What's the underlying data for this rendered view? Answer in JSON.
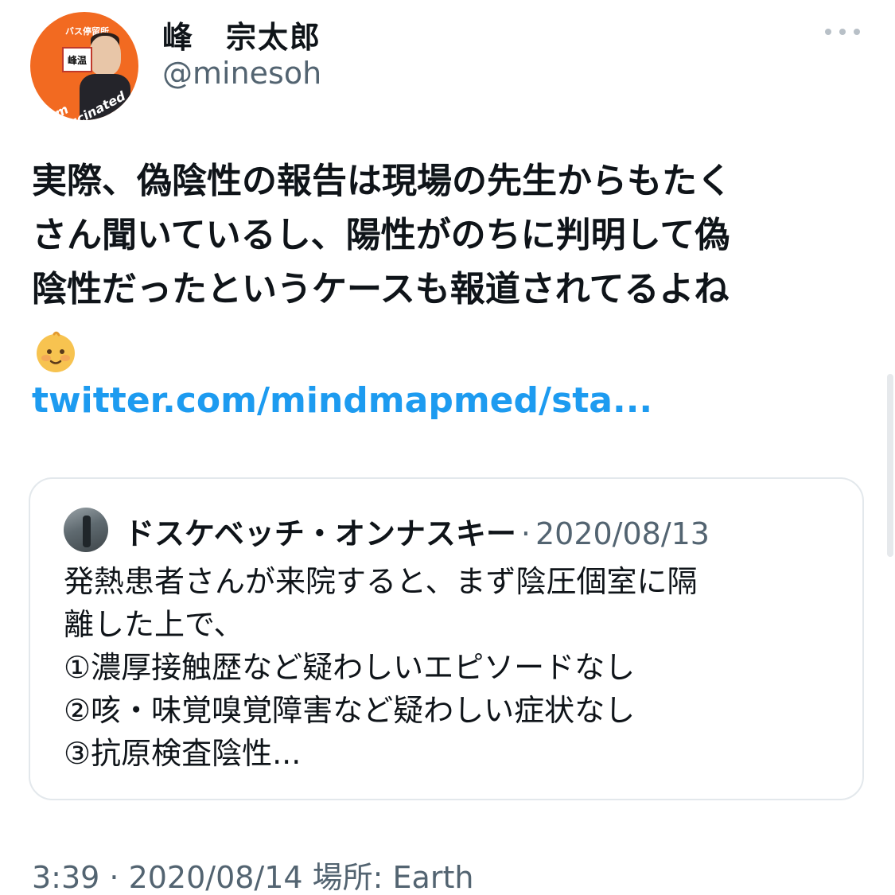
{
  "tweet": {
    "author": {
      "display_name": "峰　宗太郎",
      "username": "@minesoh",
      "avatar": {
        "top_label": "バス停留所",
        "sign_text": "峰温",
        "ring_text": "I'm Vaccinated",
        "background_color": "#f26a21"
      }
    },
    "more_icon": "more-horizontal-icon",
    "text": "実際、偽陰性の報告は現場の先生からもたく\nさん聞いているし、陽性がのちに判明して偽\n陰性だったというケースも報道されてるよね",
    "emoji": "baby-face-emoji",
    "link": "twitter.com/mindmapmed/sta...",
    "link_color": "#1d9bf0",
    "meta": "3:39 · 2020/08/14 場所: Earth"
  },
  "quote": {
    "author": "ドスケベッチ・オンナスキー",
    "separator": "·",
    "date": "2020/08/13",
    "text": "発熱患者さんが来院すると、まず陰圧個室に隔\n離した上で、\n①濃厚接触歴など疑わしいエピソードなし\n②咳・味覚嗅覚障害など疑わしい症状なし\n③抗原検査陰性..."
  }
}
